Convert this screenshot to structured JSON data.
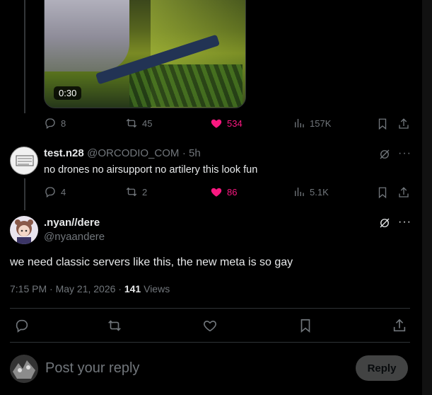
{
  "top_post": {
    "video_duration": "0:30",
    "actions": {
      "replies": "8",
      "reposts": "45",
      "likes": "534",
      "views": "157K"
    }
  },
  "reply": {
    "display_name": "test.n28",
    "handle": "@ORCODIO_COM",
    "time": "· 5h",
    "text": "no drones no airsupport no artilery this look fun",
    "actions": {
      "replies": "4",
      "reposts": "2",
      "likes": "86",
      "views": "5.1K"
    }
  },
  "main_post": {
    "display_name": ".nyan//dere",
    "handle": "@nyaandere",
    "text": "we need classic servers like this, the new meta is so gay",
    "timestamp": "7:15 PM · May 21, 2026 · ",
    "views_count": "141",
    "views_label": "Views"
  },
  "composer": {
    "placeholder": "Post your reply",
    "reply_label": "Reply"
  },
  "colors": {
    "like_pink": "#f91880",
    "muted": "#71767b",
    "divider": "#2f3336"
  }
}
